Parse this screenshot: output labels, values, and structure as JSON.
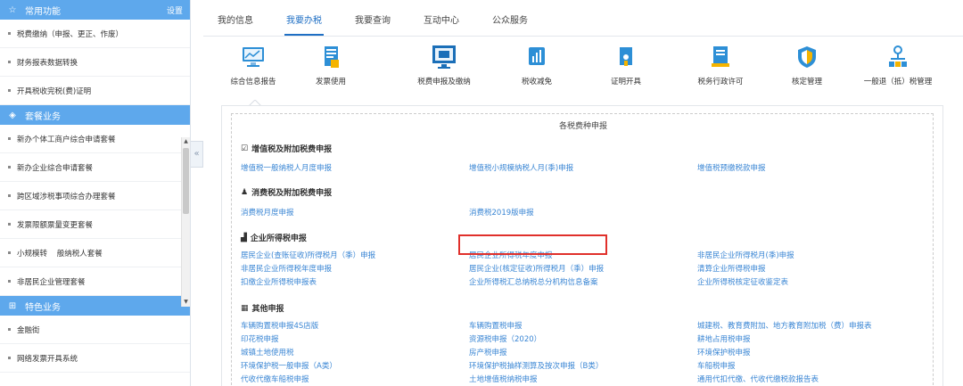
{
  "sidebar": {
    "common": {
      "title": "常用功能",
      "settings": "设置",
      "icon": "star-icon",
      "items": [
        "税费缴纳（申报、更正、作废）",
        "财务报表数据转换",
        "开具税收完税(费)证明"
      ]
    },
    "package": {
      "title": "套餐业务",
      "icon": "layers-icon",
      "items": [
        "新办个体工商户综合申请套餐",
        "新办企业综合申请套餐",
        "跨区域涉税事项综合办理套餐",
        "发票限额票量变更套餐",
        "小规模转    般纳税人套餐",
        "非居民企业管理套餐"
      ]
    },
    "special": {
      "title": "特色业务",
      "icon": "grid-icon",
      "items": [
        "金融街",
        "网络发票开具系统"
      ]
    }
  },
  "tabs": [
    "我的信息",
    "我要办税",
    "我要查询",
    "互动中心",
    "公众服务"
  ],
  "active_tab": "我要办税",
  "services": [
    {
      "label": "综合信息报告",
      "icon": "monitor-chart-icon"
    },
    {
      "label": "发票使用",
      "icon": "document-icon"
    },
    {
      "label": "税费申报及缴纳",
      "icon": "screen-icon"
    },
    {
      "label": "税收减免",
      "icon": "bar-chart-icon"
    },
    {
      "label": "证明开具",
      "icon": "certificate-icon"
    },
    {
      "label": "税务行政许可",
      "icon": "clipboard-icon"
    },
    {
      "label": "核定管理",
      "icon": "shield-icon"
    },
    {
      "label": "一般退（抵）税管理",
      "icon": "org-chart-icon"
    }
  ],
  "panel": {
    "title": "各税费种申报",
    "groups": [
      {
        "title": "增值税及附加税费申报",
        "icon": "check-square-icon",
        "links": [
          "增值税一般纳税人月度申报",
          "增值税小规模纳税人月(季)申报",
          "增值税预缴税款申报"
        ]
      },
      {
        "title": "消费税及附加税费申报",
        "icon": "user-icon",
        "links": [
          "消费税月度申报",
          "消费税2019版申报"
        ]
      },
      {
        "title": "企业所得税申报",
        "icon": "bar-chart-icon",
        "links": [
          "居民企业(查账征收)所得税月（季）申报",
          "居民企业所得税年度申报",
          "非居民企业所得税月(季)申报",
          "非居民企业所得税年度申报",
          "居民企业(核定征收)所得税月（季）申报",
          "清算企业所得税申报",
          "扣缴企业所得税申报表",
          "企业所得税汇总纳税总分机构信息备案",
          "企业所得税核定征收鉴定表"
        ]
      },
      {
        "title": "其他申报",
        "icon": "grid-icon",
        "links": [
          "车辆购置税申报4S店版",
          "车辆购置税申报",
          "城建税、教育费附加、地方教育附加税（费）申报表",
          "印花税申报",
          "资源税申报（2020）",
          "耕地占用税申报",
          "城镇土地使用税",
          "房产税申报",
          "环境保护税申报",
          "环境保护税一般申报（A类）",
          "环境保护税抽样测算及按次申报（B类）",
          "车船税申报",
          "代收代缴车船税申报",
          "土地增值税纳税申报",
          "通用代扣代缴、代收代缴税款报告表"
        ]
      }
    ]
  },
  "colors": {
    "sidebar_header": "#5ea8ec",
    "link": "#3a86d4",
    "active_tab": "#1f6fc4",
    "highlight": "#e0302b"
  }
}
